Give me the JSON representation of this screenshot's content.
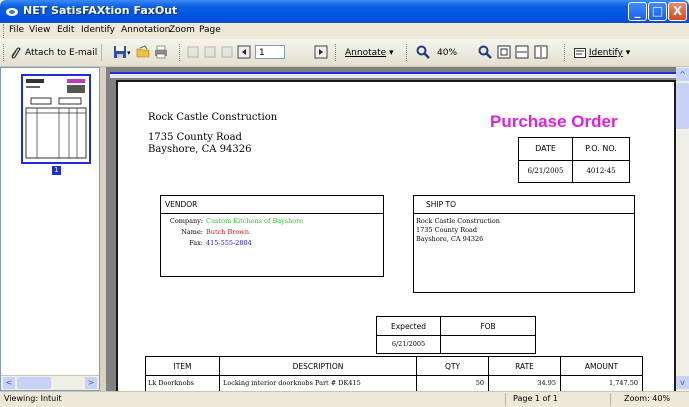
{
  "window": {
    "title": "NET SatisFAXtion FaxOut",
    "controls": [
      "_",
      "□",
      "X"
    ]
  },
  "menu": {
    "items": [
      "File",
      "View",
      "Edit",
      "Identify",
      "Annotation",
      "Zoom",
      "Page"
    ]
  },
  "toolbar": {
    "attach_label": "Attach to E-mail",
    "page_number": "1",
    "annotate_label": "Annotate",
    "zoom_value": "40%",
    "identify_label": "Identify"
  },
  "thumbnail": {
    "page_label": "1"
  },
  "document": {
    "company": "Rock Castle Construction",
    "address_line1": "1735 County Road",
    "address_line2": "Bayshore, CA 94326",
    "heading": "Purchase Order",
    "date_header": "DATE",
    "po_header": "P.O. NO.",
    "date_value": "6/21/2005",
    "po_value": "4012-45",
    "vendor_header": "VENDOR",
    "company_label": "Company:",
    "company_value": "Custom Kitchens of Bayshore",
    "name_label": "Name:",
    "name_value": "Butch Brown",
    "fax_label": "Fax:",
    "fax_value": "415-555-2804",
    "shipto_header": "SHIP TO",
    "shipto_line1": "Rock Castle Construction",
    "shipto_line2": "1735 County Road",
    "shipto_line3": "Bayshore, CA 94326",
    "expected_header": "Expected",
    "fob_header": "FOB",
    "expected_value": "6/21/2005",
    "columns": [
      "ITEM",
      "DESCRIPTION",
      "QTY",
      "RATE",
      "AMOUNT"
    ],
    "row": {
      "item": "Lk Doorknobs",
      "description": "Locking interior doorknobs  Part # DK415",
      "qty": "50",
      "rate": "34.95",
      "amount": "1,747.50"
    }
  },
  "status": {
    "left": "Viewing: Intuit",
    "page": "Page 1 of 1",
    "zoom": "Zoom: 40%"
  },
  "colors": {
    "heading": "#e020e0",
    "company_value": "#22cc22",
    "name_value": "#dd1111",
    "fax_value": "#1111dd",
    "titlebar": "#0054e3"
  }
}
